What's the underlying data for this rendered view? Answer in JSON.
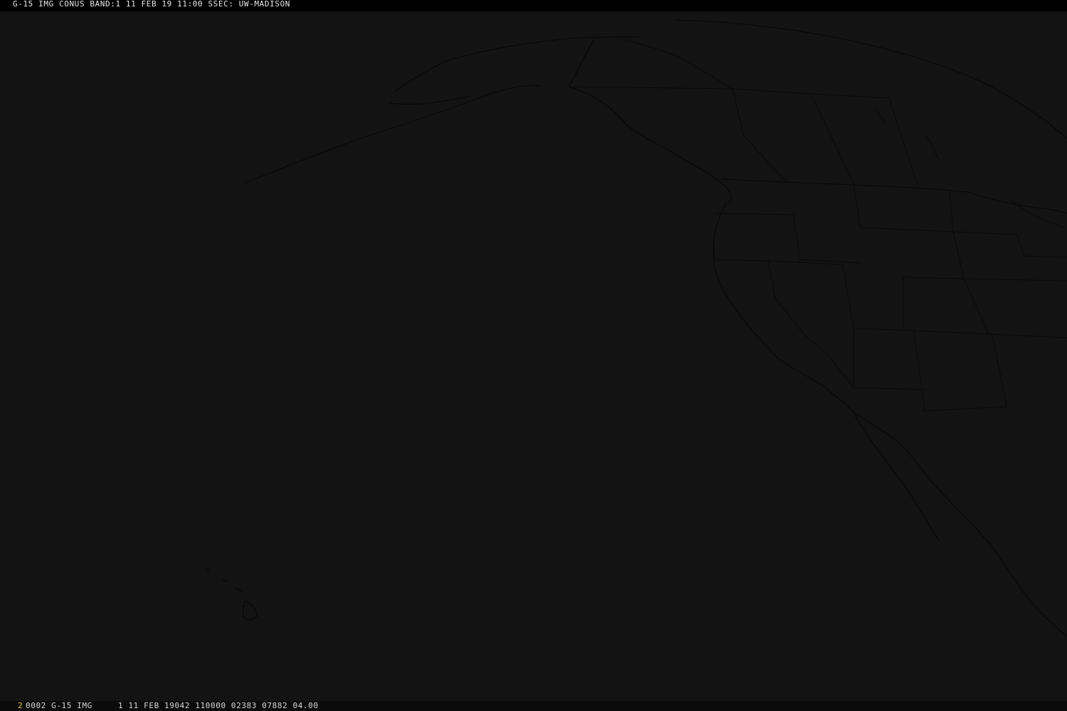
{
  "header": {
    "title": "G-15 IMG CONUS BAND:1 11 FEB 19 11:00 SSEC: UW-MADISON"
  },
  "footer": {
    "frame_index": "2",
    "frame_info": "0002 G-15 IMG     1 11 FEB 19042 110000 02383 07882 04.00"
  },
  "colors": {
    "background": "#131313",
    "header_background": "#000000",
    "header_text": "#e8e8e8",
    "frame_index": "#e8c640",
    "map_lines": "#050505"
  }
}
